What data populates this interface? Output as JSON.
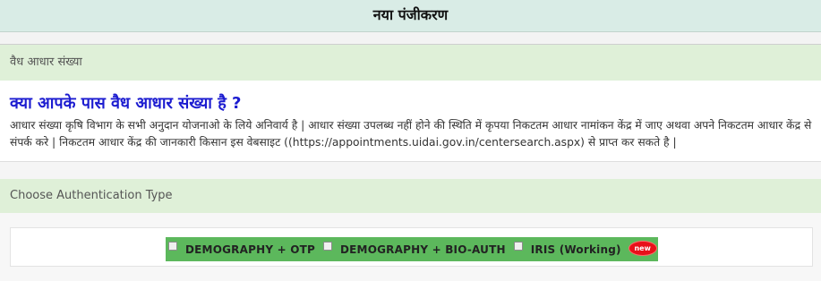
{
  "header": {
    "title": "नया पंजीकरण"
  },
  "aadhaar_section": {
    "heading": "वैध आधार संख्या",
    "question": "क्या आपके पास वैध आधार संख्या है ?",
    "description": "आधार संख्या कृषि विभाग के सभी अनुदान योजनाओ के लिये अनिवार्य है | आधार संख्या उपलब्ध नहीं होने की स्थिति में कृपया निकटतम आधार नामांकन केंद्र में जाए अथवा अपने निकटतम आधार केंद्र से संपर्क करे | निकटतम आधार केंद्र की जानकारी किसान इस वेबसाइट ((https://appointments.uidai.gov.in/centersearch.aspx) से प्राप्त कर सकते है |"
  },
  "auth_section": {
    "heading": "Choose Authentication Type",
    "options": [
      {
        "label": "DEMOGRAPHY + OTP",
        "checked": false
      },
      {
        "label": "DEMOGRAPHY + BIO-AUTH",
        "checked": false
      },
      {
        "label": "IRIS (Working)",
        "checked": false
      }
    ],
    "new_badge": "new",
    "accent_color": "#5cb85c"
  }
}
